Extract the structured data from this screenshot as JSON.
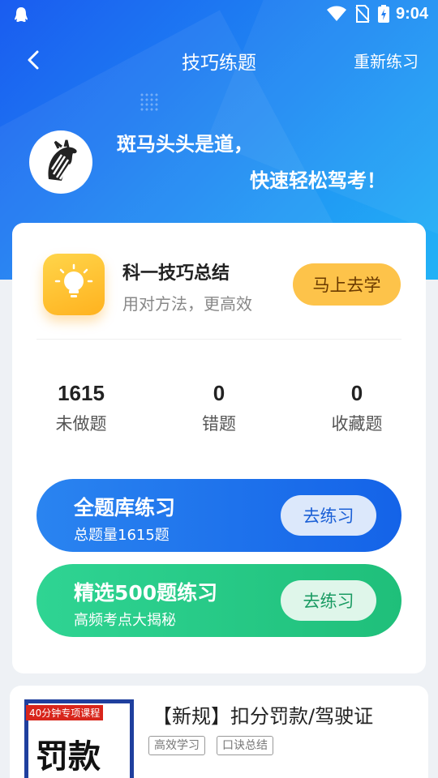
{
  "status_bar": {
    "time": "9:04"
  },
  "nav": {
    "title": "技巧练题",
    "reset_label": "重新练习"
  },
  "hero": {
    "slogan_line1": "斑马头头是道，",
    "slogan_line2": "快速轻松驾考！"
  },
  "tip_card": {
    "title": "科一技巧总结",
    "subtitle": "用对方法，更高效",
    "button_label": "马上去学"
  },
  "stats": [
    {
      "value": "1615",
      "label": "未做题"
    },
    {
      "value": "0",
      "label": "错题"
    },
    {
      "value": "0",
      "label": "收藏题"
    }
  ],
  "practice": [
    {
      "title": "全题库练习",
      "subtitle": "总题量1615题",
      "button_label": "去练习"
    },
    {
      "title": "精选500题练习",
      "subtitle": "高频考点大揭秘",
      "button_label": "去练习"
    }
  ],
  "course": {
    "badge": "40分钟专项课程",
    "thumb_text": "罚款",
    "title": "【新规】扣分罚款/驾驶证",
    "tags": [
      "高效学习",
      "口诀总结"
    ]
  },
  "colors": {
    "accent_blue": "#1a5fd6",
    "accent_green": "#1fbf7a",
    "accent_yellow": "#fdc34a"
  }
}
